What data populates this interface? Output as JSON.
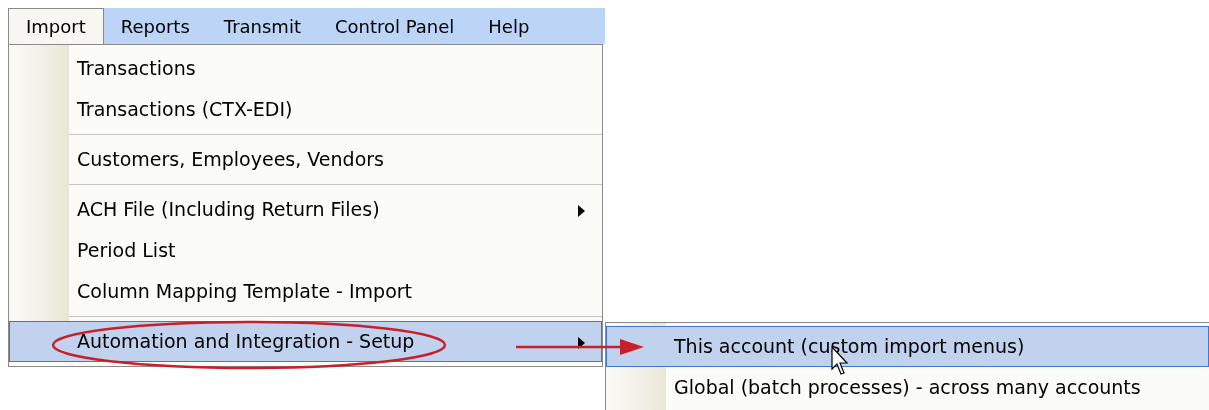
{
  "menu_bar": [
    {
      "label": "Import",
      "selected": true
    },
    {
      "label": "Reports",
      "selected": false
    },
    {
      "label": "Transmit",
      "selected": false
    },
    {
      "label": "Control Panel",
      "selected": false
    },
    {
      "label": "Help",
      "selected": false
    }
  ],
  "import_menu": [
    {
      "kind": "item",
      "label": "Transactions",
      "selected": false,
      "has_submenu": false
    },
    {
      "kind": "item",
      "label": "Transactions (CTX-EDI)",
      "selected": false,
      "has_submenu": false
    },
    {
      "kind": "separator"
    },
    {
      "kind": "item",
      "label": "Customers, Employees, Vendors",
      "selected": false,
      "has_submenu": false
    },
    {
      "kind": "separator"
    },
    {
      "kind": "item",
      "label": "ACH File (Including Return Files)",
      "selected": false,
      "has_submenu": true
    },
    {
      "kind": "item",
      "label": "Period List",
      "selected": false,
      "has_submenu": false
    },
    {
      "kind": "item",
      "label": "Column Mapping Template - Import",
      "selected": false,
      "has_submenu": false
    },
    {
      "kind": "separator"
    },
    {
      "kind": "item",
      "label": "Automation and Integration - Setup",
      "selected": true,
      "has_submenu": true
    }
  ],
  "submenu": [
    {
      "kind": "item",
      "label": "This account (custom import menus)",
      "selected": true,
      "has_submenu": false
    },
    {
      "kind": "item",
      "label": "Global (batch processes) - across many accounts",
      "selected": false,
      "has_submenu": false
    }
  ]
}
